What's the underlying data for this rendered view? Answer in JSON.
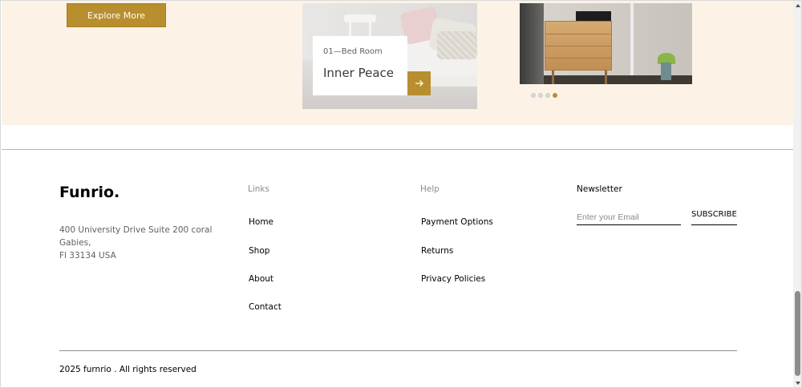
{
  "hero": {
    "explore_button": "Explore More",
    "card_subtitle": "01",
    "card_subtitle_sep": "—",
    "card_category": "Bed Room",
    "card_title": "Inner Peace",
    "arrow_icon": "arrow-right-icon",
    "slider_dots": 4,
    "active_dot": 4
  },
  "footer": {
    "brand": "Funrio.",
    "address_lines": [
      "400 University Drive Suite 200 coral",
      "Gabies,",
      "Fl 33134 USA"
    ],
    "links": {
      "title": "Links",
      "items": [
        "Home",
        "Shop",
        "About",
        "Contact"
      ]
    },
    "help": {
      "title": "Help",
      "items": [
        "Payment Options",
        "Returns",
        "Privacy Policies"
      ]
    },
    "newsletter": {
      "title": "Newsletter",
      "placeholder": "Enter your Email",
      "button": "SUBSCRIBE"
    },
    "copyright": "2025 furnrio . All rights reserved"
  },
  "colors": {
    "accent": "#b88e2f",
    "hero_bg": "#fcf3e6"
  }
}
